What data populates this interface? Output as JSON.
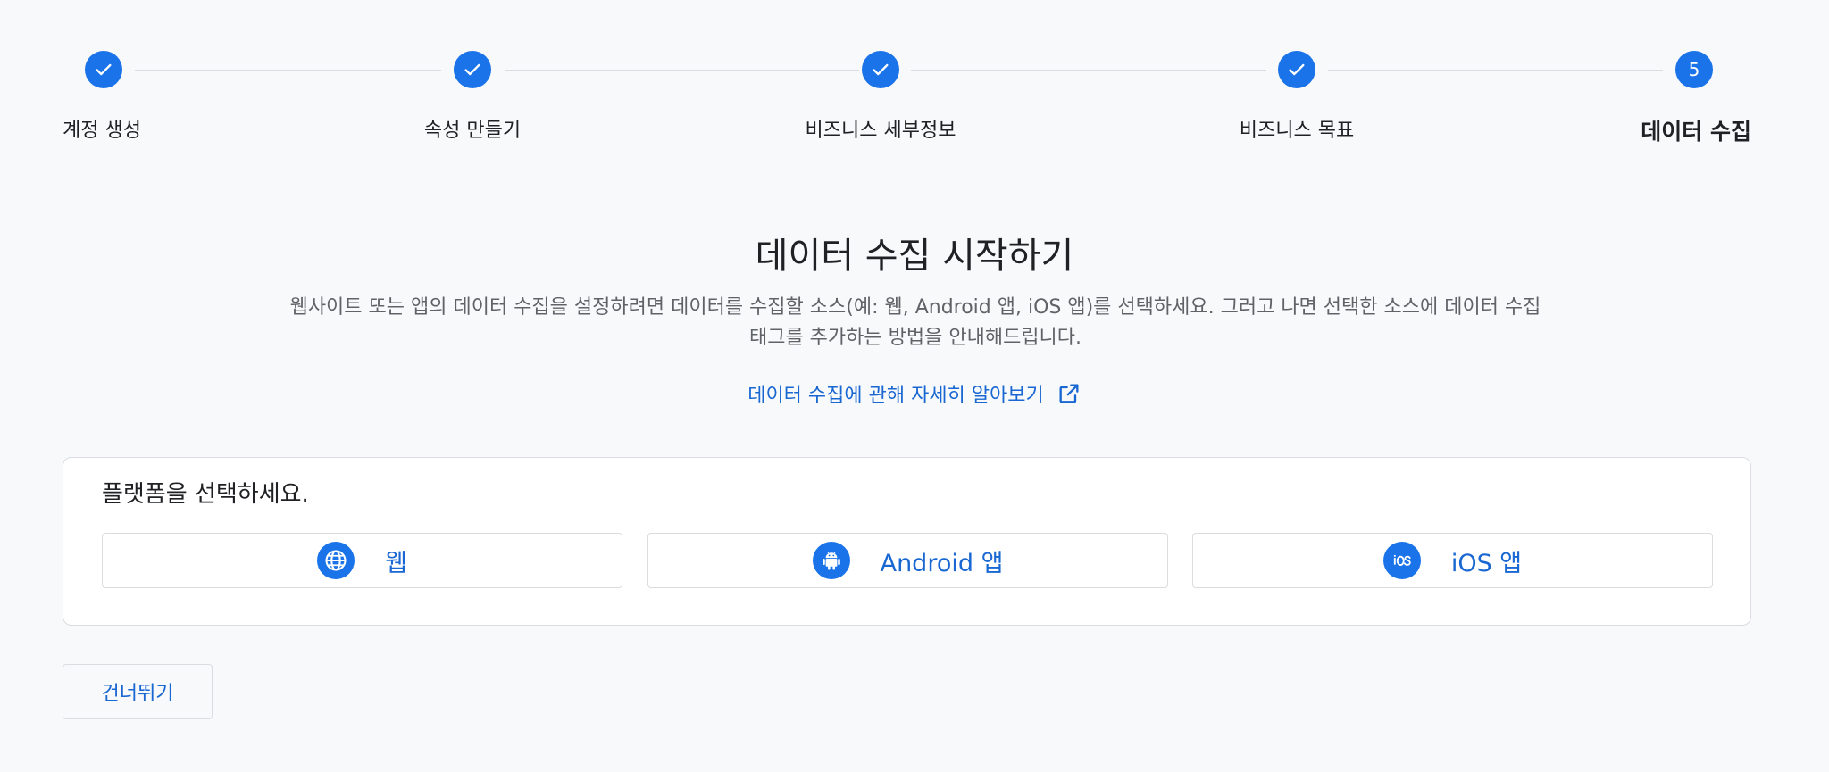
{
  "stepper": {
    "steps": [
      {
        "label": "계정 생성",
        "state": "done"
      },
      {
        "label": "속성 만들기",
        "state": "done"
      },
      {
        "label": "비즈니스 세부정보",
        "state": "done"
      },
      {
        "label": "비즈니스 목표",
        "state": "done"
      },
      {
        "label": "데이터 수집",
        "state": "current",
        "number": "5"
      }
    ]
  },
  "main": {
    "title": "데이터 수집 시작하기",
    "description": "웹사이트 또는 앱의 데이터 수집을 설정하려면 데이터를 수집할 소스(예: 웹, Android 앱, iOS 앱)를 선택하세요. 그러고 나면 선택한 소스에 데이터 수집 태그를 추가하는 방법을 안내해드립니다.",
    "learn_more": "데이터 수집에 관해 자세히 알아보기"
  },
  "platform_card": {
    "title": "플랫폼을 선택하세요.",
    "buttons": [
      {
        "label": "웹",
        "icon": "globe-icon"
      },
      {
        "label": "Android 앱",
        "icon": "android-icon"
      },
      {
        "label": "iOS 앱",
        "icon": "ios-icon"
      }
    ]
  },
  "footer": {
    "skip_label": "건너뛰기"
  },
  "colors": {
    "accent": "#1a73e8",
    "link": "#1967d2",
    "border": "#dadce0",
    "background": "#f8f9fa"
  }
}
